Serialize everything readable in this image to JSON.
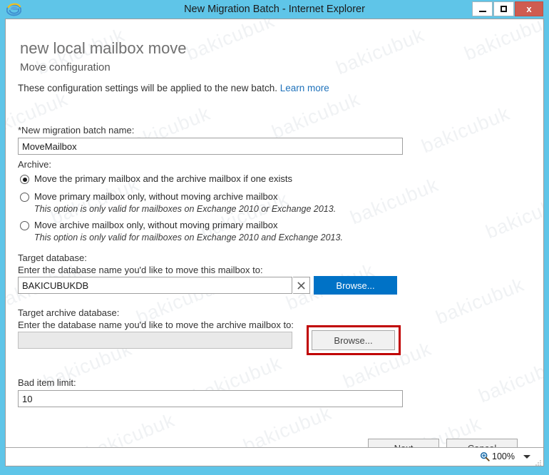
{
  "window": {
    "title": "New Migration Batch - Internet Explorer",
    "app_icon": "internet-explorer-icon",
    "controls": {
      "minimize": "minimize-icon",
      "maximize": "maximize-icon",
      "close_label": "x"
    },
    "frame_color": "#5fc5e8"
  },
  "page": {
    "heading": "new local mailbox move",
    "subheading": "Move configuration",
    "intro_text": "These configuration settings will be applied to the new batch.",
    "learn_more_label": "Learn more",
    "link_color": "#1f72bb"
  },
  "form": {
    "batch_name": {
      "label": "*New migration batch name:",
      "value": "MoveMailbox",
      "placeholder": ""
    },
    "archive": {
      "label": "Archive:",
      "options": [
        {
          "label": "Move the primary mailbox and the archive mailbox if one exists",
          "note": "",
          "selected": true
        },
        {
          "label": "Move primary mailbox only, without moving archive mailbox",
          "note": "This option is only valid for mailboxes on Exchange 2010 or Exchange 2013.",
          "selected": false
        },
        {
          "label": "Move archive mailbox only, without moving primary mailbox",
          "note": "This option is only valid for mailboxes on Exchange 2010 and Exchange 2013.",
          "selected": false
        }
      ]
    },
    "target_database": {
      "label": "Target database:",
      "hint": "Enter the database name you'd like to move this mailbox to:",
      "value": "BAKICUBUKDB",
      "clear_icon": "clear-x-icon",
      "browse_label": "Browse...",
      "browse_color": "#0072c6"
    },
    "target_archive_database": {
      "label": "Target archive database:",
      "hint": "Enter the database name you'd like to move the archive mailbox to:",
      "value": "",
      "browse_label": "Browse...",
      "highlight_color": "#c00000"
    },
    "bad_item_limit": {
      "label": "Bad item limit:",
      "value": "10"
    }
  },
  "footer": {
    "next_label": "Next",
    "cancel_label": "Cancel"
  },
  "statusbar": {
    "zoom_icon": "zoom-magnifier-icon",
    "zoom_level": "100%",
    "caret_icon": "chevron-down-icon",
    "grip_icon": "resize-grip-icon"
  },
  "watermark": {
    "text": "bakicubuk"
  }
}
